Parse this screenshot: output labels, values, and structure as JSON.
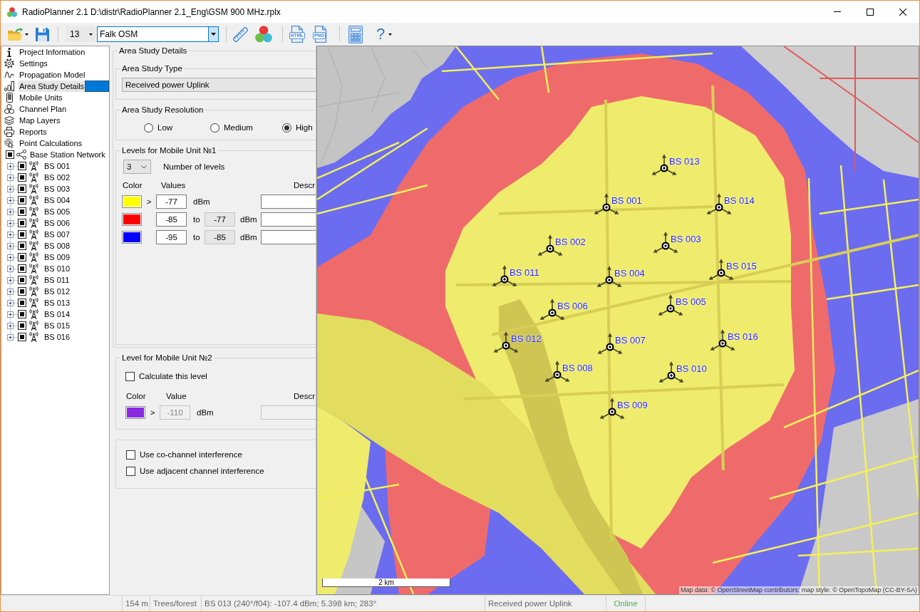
{
  "window": {
    "title": "RadioPlanner 2.1 D:\\distr\\RadioPlanner 2.1_Eng\\GSM 900 MHz.rplx"
  },
  "toolbar": {
    "zoom": "13",
    "map_source": "Falk OSM",
    "export_formats": [
      "HTML",
      "PNG"
    ],
    "help": "?"
  },
  "sidebar": {
    "pages": [
      {
        "label": "Project Information",
        "selected": false
      },
      {
        "label": "Settings",
        "selected": false
      },
      {
        "label": "Propagation Model",
        "selected": false
      },
      {
        "label": "Area Study Details",
        "selected": true
      },
      {
        "label": "Mobile Units",
        "selected": false
      },
      {
        "label": "Channel Plan",
        "selected": false
      },
      {
        "label": "Map Layers",
        "selected": false
      },
      {
        "label": "Reports",
        "selected": false
      },
      {
        "label": "Point Calculations",
        "selected": false
      }
    ],
    "network": {
      "label": "Base Station Network",
      "checked": true,
      "children": [
        {
          "label": "BS 001",
          "checked": true,
          "expanded": false,
          "selected": false
        },
        {
          "label": "BS 002",
          "checked": true,
          "expanded": false,
          "selected": false
        },
        {
          "label": "BS 003",
          "checked": true,
          "expanded": false,
          "selected": false
        },
        {
          "label": "BS 004",
          "checked": true,
          "expanded": false,
          "selected": false
        },
        {
          "label": "BS 005",
          "checked": true,
          "expanded": false,
          "selected": false
        },
        {
          "label": "BS 006",
          "checked": true,
          "expanded": false,
          "selected": false
        },
        {
          "label": "BS 007",
          "checked": true,
          "expanded": false,
          "selected": false
        },
        {
          "label": "BS 008",
          "checked": true,
          "expanded": false,
          "selected": false
        },
        {
          "label": "BS 009",
          "checked": true,
          "expanded": false,
          "selected": false
        },
        {
          "label": "BS 010",
          "checked": true,
          "expanded": false,
          "selected": false
        },
        {
          "label": "BS 011",
          "checked": true,
          "expanded": false,
          "selected": false
        },
        {
          "label": "BS 012",
          "checked": true,
          "expanded": false,
          "selected": false
        },
        {
          "label": "BS 013",
          "checked": true,
          "expanded": false,
          "selected": false
        },
        {
          "label": "BS 014",
          "checked": true,
          "expanded": false,
          "selected": false
        },
        {
          "label": "BS 015",
          "checked": true,
          "expanded": false,
          "selected": false
        },
        {
          "label": "BS 016",
          "checked": true,
          "expanded": false,
          "selected": false
        }
      ]
    }
  },
  "details": {
    "title": "Area Study Details",
    "study_type": {
      "title": "Area Study Type",
      "value": "Received power Uplink"
    },
    "resolution": {
      "title": "Area Study Resolution",
      "options": [
        {
          "label": "Low",
          "selected": false
        },
        {
          "label": "Medium",
          "selected": false
        },
        {
          "label": "High",
          "selected": true
        }
      ]
    },
    "levels_1": {
      "title": "Levels for Mobile Unit №1",
      "count": "3",
      "count_label": "Number of levels",
      "color_header": "Color",
      "values_header": "Values",
      "description_header": "Descr",
      "levels": [
        {
          "kind": "above",
          "color": "#ffff00",
          "sign": ">",
          "value": "-77",
          "unit": "dBm"
        },
        {
          "kind": "range",
          "color": "#ff0000",
          "value": "-85",
          "joiner": "to",
          "upper": "-77",
          "unit": "dBm"
        },
        {
          "kind": "range",
          "color": "#0000ff",
          "value": "-95",
          "joiner": "to",
          "upper": "-85",
          "unit": "dBm"
        }
      ]
    },
    "levels_2": {
      "title": "Level for Mobile Unit №2",
      "calculate": {
        "label": "Calculate this level",
        "checked": false
      },
      "color_header": "Color",
      "value_header": "Value",
      "description_header": "Descr",
      "color": "#8a2be2",
      "sign": ">",
      "value": "-110",
      "unit": "dBm",
      "disabled": true
    },
    "interference": [
      {
        "label": "Use co-channel interference",
        "checked": false
      },
      {
        "label": "Use adjacent channel interference",
        "checked": false
      }
    ]
  },
  "map": {
    "base_stations": [
      {
        "label": "BS 013"
      },
      {
        "label": "BS 001"
      },
      {
        "label": "BS 014"
      },
      {
        "label": "BS 002"
      },
      {
        "label": "BS 003"
      },
      {
        "label": "BS 011"
      },
      {
        "label": "BS 004"
      },
      {
        "label": "BS 015"
      },
      {
        "label": "BS 006"
      },
      {
        "label": "BS 005"
      },
      {
        "label": "BS 012"
      },
      {
        "label": "BS 007"
      },
      {
        "label": "BS 016"
      },
      {
        "label": "BS 008"
      },
      {
        "label": "BS 010"
      },
      {
        "label": "BS 009"
      }
    ],
    "scale": "2 km",
    "attribution": "Map data: © OpenStreetMap contributors; map style: © OpenTopoMap (CC-BY-SA)"
  },
  "status_bar": {
    "cells": [
      "154 m",
      "Trees/forest",
      "BS 013 (240°/f04): -107.4 dBm; 5.398 km; 283°",
      "Received power Uplink"
    ],
    "connection": "Online"
  }
}
